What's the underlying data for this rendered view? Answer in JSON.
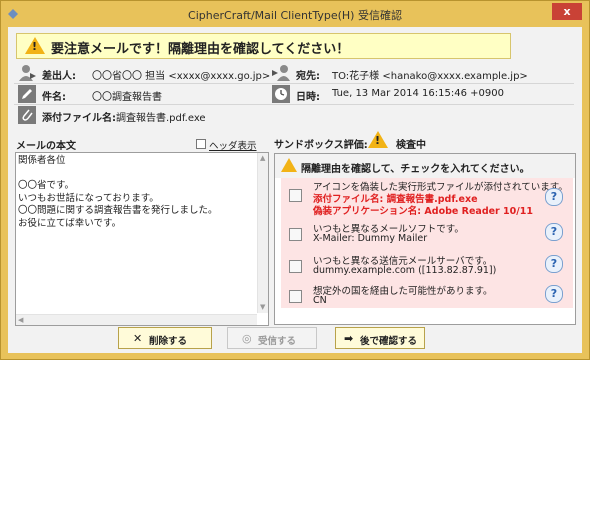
{
  "window": {
    "title": "CipherCraft/Mail ClientType(H) 受信確認",
    "close_label": "x"
  },
  "banner": {
    "text": "要注意メールです！隔離理由を確認してください！"
  },
  "header": {
    "from_label": "差出人:",
    "from_value": "〇〇省〇〇 担当 <xxxx@xxxx.go.jp>",
    "to_label": "宛先:",
    "to_value": "TO:花子様 <hanako@xxxx.example.jp>",
    "subject_label": "件名:",
    "subject_value": "〇〇調査報告書",
    "date_label": "日時:",
    "date_value": "Tue, 13 Mar 2014 16:15:46 +0900",
    "attachment_label": "添付ファイル名:",
    "attachment_value": "調査報告書.pdf.exe"
  },
  "body_pane": {
    "title": "メールの本文",
    "header_toggle_label": "ヘッダ表示",
    "lines": [
      "関係者各位",
      "",
      "〇〇省です。",
      "いつもお世話になっております。",
      "〇〇問題に関する調査報告書を発行しました。",
      "お役に立てば幸いです。"
    ]
  },
  "sandbox": {
    "eval_label": "サンドボックス評価:",
    "eval_status": "検査中",
    "instruction": "隔離理由を確認して、チェックを入れてください。",
    "items": [
      {
        "line1": "アイコンを偽装した実行形式ファイルが添付されています。",
        "line2": "添付ファイル名: 調査報告書.pdf.exe",
        "line3": "偽装アプリケーション名: Adobe Reader 10/11"
      },
      {
        "line1": "いつもと異なるメールソフトです。",
        "line2": "X-Mailer: Dummy Mailer"
      },
      {
        "line1": "いつもと異なる送信元メールサーバです。",
        "line2": "dummy.example.com ([113.82.87.91])"
      },
      {
        "line1": "想定外の国を経由した可能性があります。",
        "line2": "CN"
      }
    ],
    "help_label": "?"
  },
  "buttons": {
    "delete": "削除する",
    "receive": "受信する",
    "later": "後で確認する"
  },
  "colors": {
    "frame": "#e8c25a",
    "warning": "#f2b316",
    "alert_text": "#e02020",
    "item_bg": "#fde4e4"
  }
}
